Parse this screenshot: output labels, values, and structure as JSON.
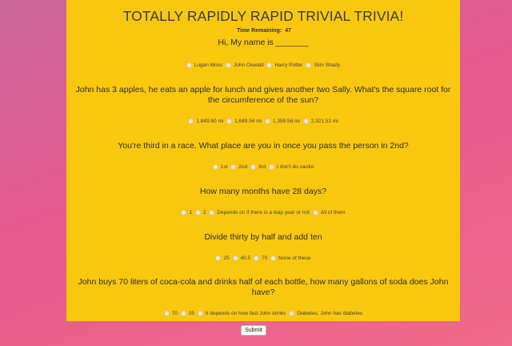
{
  "header": {
    "title": "TOTALLY RAPIDLY RAPID TRIVIAL TRIVIA!",
    "timer_label": "Time Remaining:",
    "timer_value": "47"
  },
  "questions": [
    {
      "text": "Hi, My name is _______",
      "options": [
        "Logan Moss",
        "John Oswald",
        "Harry Potter",
        "Slim Shady"
      ]
    },
    {
      "text": "John has 3 apples, he eats an apple for lunch and gives another two Sally. What's the square root for the circumference of the sun?",
      "options": [
        "1,849.60 mi",
        "1,649.54 mi",
        "1,359.58 mi",
        "2,321.52 mi"
      ]
    },
    {
      "text": "You're third in a race. What place are you in once you pass the person in 2nd?",
      "options": [
        "1st",
        "2nd",
        "3rd",
        "I don't do cardio"
      ]
    },
    {
      "text": "How many months have 28 days?",
      "options": [
        "1",
        "2",
        "Depends on if there is a leap year or not",
        "All of them"
      ]
    },
    {
      "text": "Divide thirty by half and add ten",
      "options": [
        "25",
        "40.5",
        "70",
        "None of these"
      ]
    },
    {
      "text": "John buys 70 liters of coca-cola and drinks half of each bottle, how many gallons of soda does John have?",
      "options": [
        "70",
        "35",
        "It depends on how fast John drinks",
        "Diabetes, John has diabetes"
      ]
    }
  ],
  "form": {
    "submit_label": "Submit"
  },
  "colors": {
    "panel": "#f9c80e",
    "background_start": "#c9679a",
    "background_end": "#f06a8c"
  }
}
